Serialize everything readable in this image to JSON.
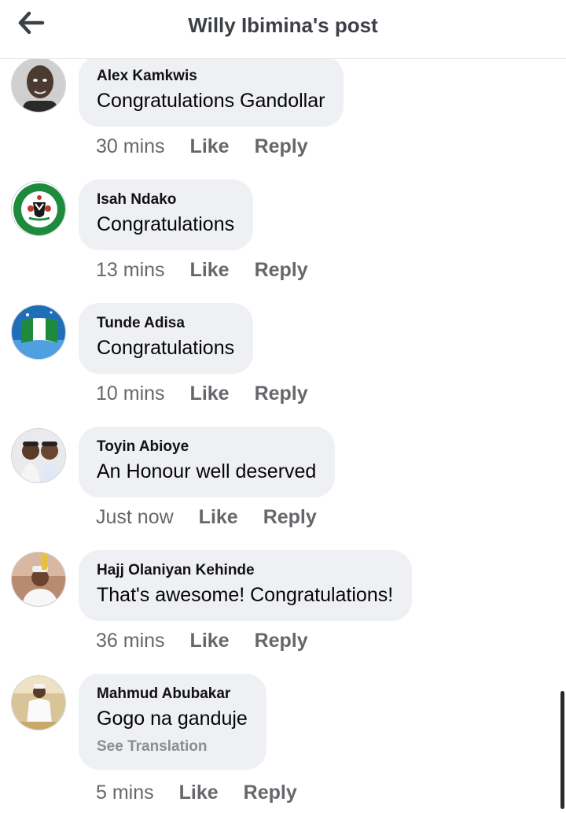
{
  "header": {
    "title": "Willy Ibimina's post",
    "back_icon": "arrow-left-icon"
  },
  "comments": [
    {
      "author": "Alex Kamkwis",
      "text": "Congratulations Gandollar",
      "time": "30 mins",
      "like": "Like",
      "reply": "Reply",
      "avatar": "portrait-photo"
    },
    {
      "author": "Isah Ndako",
      "text": "Congratulations",
      "time": "13 mins",
      "like": "Like",
      "reply": "Reply",
      "avatar": "coat-of-arms-emblem"
    },
    {
      "author": "Tunde Adisa",
      "text": "Congratulations",
      "time": "10 mins",
      "like": "Like",
      "reply": "Reply",
      "avatar": "flag-photo"
    },
    {
      "author": "Toyin Abioye",
      "text": "An Honour well deserved",
      "time": "Just now",
      "like": "Like",
      "reply": "Reply",
      "avatar": "children-photo"
    },
    {
      "author": "Hajj Olaniyan Kehinde",
      "text": "That's awesome! Congratulations!",
      "time": "36 mins",
      "like": "Like",
      "reply": "Reply",
      "avatar": "man-in-cap-photo"
    },
    {
      "author": "Mahmud Abubakar",
      "text": "Gogo na ganduje",
      "translation": "See Translation",
      "time": "5 mins",
      "like": "Like",
      "reply": "Reply",
      "avatar": "man-in-white-robe-photo"
    }
  ],
  "colors": {
    "bubble": "#eff0f3",
    "meta_text": "#65676b",
    "title_text": "#3d4047",
    "flag_green": "#1d8a3c"
  }
}
